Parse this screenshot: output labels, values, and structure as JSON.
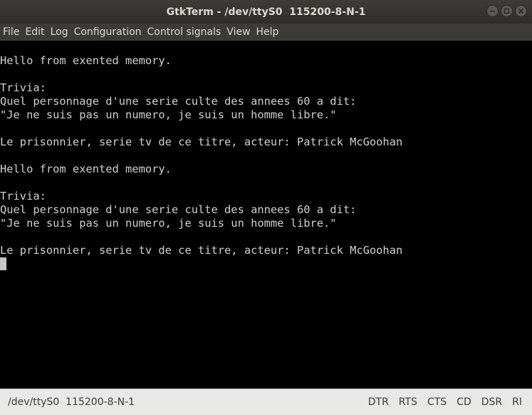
{
  "window": {
    "title": "GtkTerm - /dev/ttyS0  115200-8-N-1"
  },
  "menu": [
    {
      "label": "File"
    },
    {
      "label": "Edit"
    },
    {
      "label": "Log"
    },
    {
      "label": "Configuration"
    },
    {
      "label": "Control signals"
    },
    {
      "label": "View"
    },
    {
      "label": "Help"
    }
  ],
  "terminal": {
    "lines": [
      "Hello from exented memory.",
      "",
      "Trivia:",
      "Quel personnage d'une serie culte des annees 60 a dit:",
      "\"Je ne suis pas un numero, je suis un homme libre.\"",
      "",
      "Le prisonnier, serie tv de ce titre, acteur: Patrick McGoohan",
      "",
      "Hello from exented memory.",
      "",
      "Trivia:",
      "Quel personnage d'une serie culte des annees 60 a dit:",
      "\"Je ne suis pas un numero, je suis un homme libre.\"",
      "",
      "Le prisonnier, serie tv de ce titre, acteur: Patrick McGoohan"
    ]
  },
  "status": {
    "port": "/dev/ttyS0  115200-8-N-1",
    "signals": [
      "DTR",
      "RTS",
      "CTS",
      "CD",
      "DSR",
      "RI"
    ]
  },
  "colors": {
    "terminal_bg": "#000000",
    "terminal_fg": "#d0d0d0",
    "titlebar_bg": "#3c3b37",
    "statusbar_bg": "#e8e8e7"
  },
  "icons": {
    "minimize": "minimize-icon",
    "maximize": "maximize-icon",
    "close": "close-icon"
  }
}
